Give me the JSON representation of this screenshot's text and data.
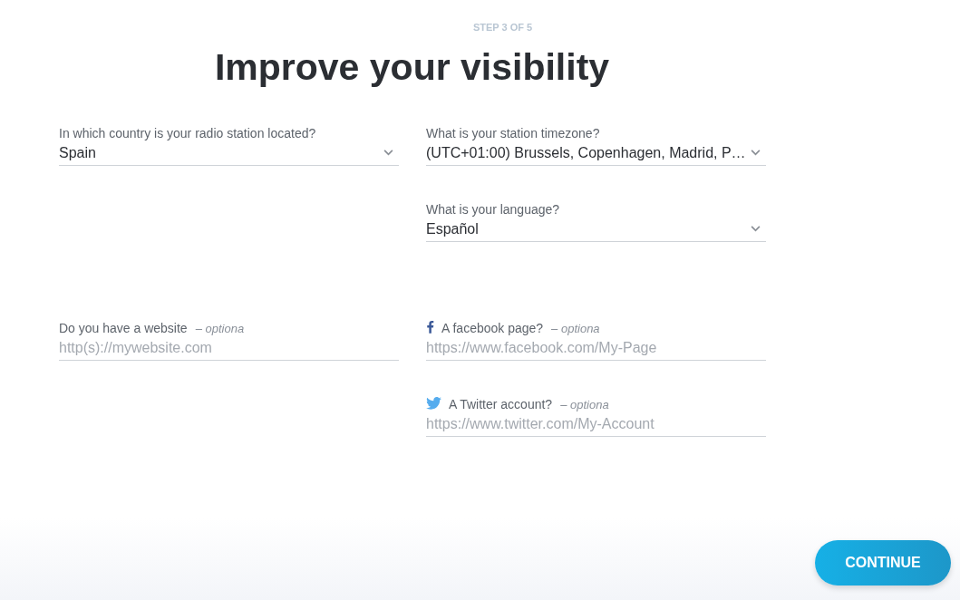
{
  "step": "STEP 3 OF 5",
  "title": "Improve your visibility",
  "sections": [
    {
      "left": [
        {
          "kind": "select",
          "label": "In which country is your radio station located?",
          "value": "Spain"
        }
      ],
      "right": [
        {
          "kind": "select",
          "label": "What is your station timezone?",
          "value": "(UTC+01:00) Brussels, Copenhagen, Madrid, P…"
        },
        {
          "kind": "select",
          "label": "What is your language?",
          "value": "Español"
        }
      ]
    },
    {
      "left": [
        {
          "kind": "text",
          "label": "Do you have a website",
          "optional": "– optiona",
          "placeholder": "http(s)://mywebsite.com"
        }
      ],
      "right": [
        {
          "kind": "facebook",
          "label": "A facebook page?",
          "optional": "– optiona",
          "placeholder": "https://www.facebook.com/My-Page"
        },
        {
          "kind": "twitter",
          "label": "A Twitter account?",
          "optional": "– optiona",
          "placeholder": "https://www.twitter.com/My-Account"
        }
      ]
    }
  ],
  "button": "CONTINUE"
}
